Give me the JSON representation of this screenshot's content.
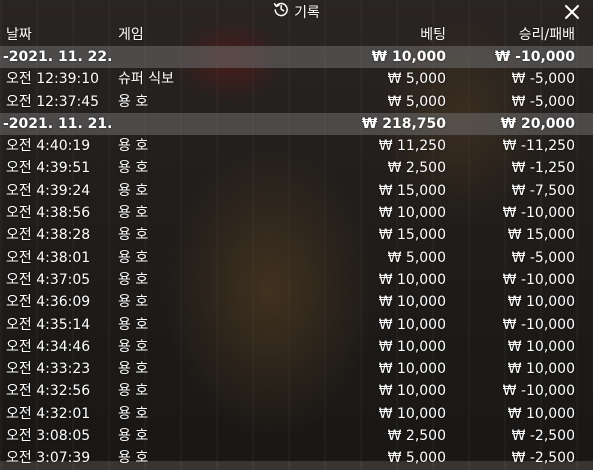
{
  "title": "기록",
  "columns": {
    "date": "날짜",
    "game": "게임",
    "bet": "베팅",
    "result": "승리/패배"
  },
  "rows": [
    {
      "type": "group",
      "date": "-2021. 11. 22.",
      "game": "",
      "bet": "₩ 10,000",
      "result": "₩ -10,000"
    },
    {
      "type": "item",
      "date": "오전 12:39:10",
      "game": "슈퍼 식보",
      "bet": "₩ 5,000",
      "result": "₩ -5,000"
    },
    {
      "type": "item",
      "date": "오전 12:37:45",
      "game": "용 호",
      "bet": "₩ 5,000",
      "result": "₩ -5,000"
    },
    {
      "type": "group",
      "date": "-2021. 11. 21.",
      "game": "",
      "bet": "₩ 218,750",
      "result": "₩ 20,000"
    },
    {
      "type": "item",
      "date": "오전 4:40:19",
      "game": "용 호",
      "bet": "₩ 11,250",
      "result": "₩ -11,250"
    },
    {
      "type": "item",
      "date": "오전 4:39:51",
      "game": "용 호",
      "bet": "₩ 2,500",
      "result": "₩ -1,250"
    },
    {
      "type": "item",
      "date": "오전 4:39:24",
      "game": "용 호",
      "bet": "₩ 15,000",
      "result": "₩ -7,500"
    },
    {
      "type": "item",
      "date": "오전 4:38:56",
      "game": "용 호",
      "bet": "₩ 10,000",
      "result": "₩ -10,000"
    },
    {
      "type": "item",
      "date": "오전 4:38:28",
      "game": "용 호",
      "bet": "₩ 15,000",
      "result": "₩ 15,000"
    },
    {
      "type": "item",
      "date": "오전 4:38:01",
      "game": "용 호",
      "bet": "₩ 5,000",
      "result": "₩ -5,000"
    },
    {
      "type": "item",
      "date": "오전 4:37:05",
      "game": "용 호",
      "bet": "₩ 10,000",
      "result": "₩ -10,000"
    },
    {
      "type": "item",
      "date": "오전 4:36:09",
      "game": "용 호",
      "bet": "₩ 10,000",
      "result": "₩ 10,000"
    },
    {
      "type": "item",
      "date": "오전 4:35:14",
      "game": "용 호",
      "bet": "₩ 10,000",
      "result": "₩ -10,000"
    },
    {
      "type": "item",
      "date": "오전 4:34:46",
      "game": "용 호",
      "bet": "₩ 10,000",
      "result": "₩ 10,000"
    },
    {
      "type": "item",
      "date": "오전 4:33:23",
      "game": "용 호",
      "bet": "₩ 10,000",
      "result": "₩ 10,000"
    },
    {
      "type": "item",
      "date": "오전 4:32:56",
      "game": "용 호",
      "bet": "₩ 10,000",
      "result": "₩ -10,000"
    },
    {
      "type": "item",
      "date": "오전 4:32:01",
      "game": "용 호",
      "bet": "₩ 10,000",
      "result": "₩ 10,000"
    },
    {
      "type": "item",
      "date": "오전 3:08:05",
      "game": "용 호",
      "bet": "₩ 2,500",
      "result": "₩ -2,500"
    },
    {
      "type": "item",
      "date": "오전 3:07:39",
      "game": "용 호",
      "bet": "₩ 5,000",
      "result": "₩ -2,500"
    }
  ],
  "icons": {
    "title": "history-icon",
    "close": "close-icon"
  },
  "colors": {
    "text": "#ffffff",
    "group_row_bg": "#6e6e6e"
  }
}
